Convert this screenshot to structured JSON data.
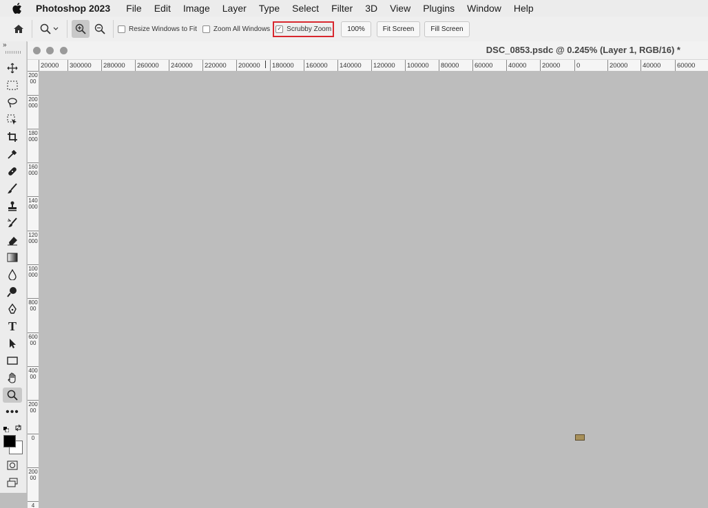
{
  "menubar": {
    "app_name": "Photoshop 2023",
    "items": [
      "File",
      "Edit",
      "Image",
      "Layer",
      "Type",
      "Select",
      "Filter",
      "3D",
      "View",
      "Plugins",
      "Window",
      "Help"
    ]
  },
  "options": {
    "resize_windows": "Resize Windows to Fit",
    "zoom_all": "Zoom All Windows",
    "scrubby_zoom": "Scrubby Zoom",
    "zoom_percent": "100%",
    "fit_screen": "Fit Screen",
    "fill_screen": "Fill Screen",
    "checked": {
      "resize_windows": false,
      "zoom_all": false,
      "scrubby_zoom": true
    }
  },
  "document": {
    "title": "DSC_0853.psdc @ 0.245% (Layer 1, RGB/16) *"
  },
  "ruler": {
    "h_labels": [
      "20000",
      "300000",
      "280000",
      "260000",
      "240000",
      "220000",
      "200000",
      "180000",
      "160000",
      "140000",
      "120000",
      "100000",
      "80000",
      "60000",
      "40000",
      "20000",
      "0",
      "20000",
      "40000",
      "60000"
    ],
    "v_labels": [
      "20000",
      "200000",
      "180000",
      "160000",
      "140000",
      "120000",
      "100000",
      "80000",
      "60000",
      "40000",
      "20000",
      "0",
      "20000",
      "4"
    ]
  },
  "tools": [
    "move-tool",
    "marquee-tool",
    "lasso-tool",
    "object-select-tool",
    "crop-tool",
    "eyedropper-tool",
    "healing-brush-tool",
    "brush-tool",
    "clone-stamp-tool",
    "history-brush-tool",
    "eraser-tool",
    "gradient-tool",
    "blur-tool",
    "dodge-tool",
    "pen-tool",
    "type-tool",
    "path-select-tool",
    "rectangle-tool",
    "hand-tool",
    "zoom-tool",
    "more-tools",
    "quick-mask",
    "screen-mode"
  ],
  "colors": {
    "accent_highlight": "#d8262d",
    "foreground": "#000000",
    "background": "#ffffff"
  }
}
